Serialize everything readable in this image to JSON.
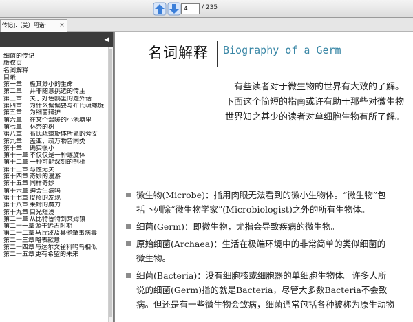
{
  "toolbar": {
    "prev_icon": "arrow-up-icon",
    "next_icon": "arrow-down-icon",
    "current_page": "4",
    "total_pages": "/ 235",
    "accent": "#3b7fd9"
  },
  "tab": {
    "title": "传记].（美）阿诺·",
    "close": "×"
  },
  "sidebar": {
    "collapse": "◀",
    "items": [
      {
        "ch": "",
        "label": "细菌的传记"
      },
      {
        "ch": "",
        "label": "版权页"
      },
      {
        "ch": "",
        "label": "名词解释"
      },
      {
        "ch": "",
        "label": "目录"
      },
      {
        "ch": "第一章",
        "label": "极其渺小的生命"
      },
      {
        "ch": "第二章",
        "label": "并非随意挑选的传主"
      },
      {
        "ch": "第三章",
        "label": "关于好色鸥鉴的题外话"
      },
      {
        "ch": "第四章",
        "label": "为什么偏偏要写布氏疏螺旋"
      },
      {
        "ch": "第五章",
        "label": "为细菌辩护"
      },
      {
        "ch": "第六章",
        "label": "在某个温暖的小池塘里"
      },
      {
        "ch": "第七章",
        "label": "林奈的树"
      },
      {
        "ch": "第八章",
        "label": "布氏疏螺旋体所处的旁支"
      },
      {
        "ch": "第九章",
        "label": "盖亚，疏万物皆同类"
      },
      {
        "ch": "第十章",
        "label": "确实很小"
      },
      {
        "ch": "第十一章",
        "label": "不仅仅是一种螺旋体"
      },
      {
        "ch": "第十二章",
        "label": "一种可能深刻的剖析"
      },
      {
        "ch": "第十三章",
        "label": "与性无关"
      },
      {
        "ch": "第十四章",
        "label": "奇妙的漫游"
      },
      {
        "ch": "第十五章",
        "label": "同样奇妙"
      },
      {
        "ch": "第十六章",
        "label": "蜱会生病吗"
      },
      {
        "ch": "第十七章",
        "label": "皮疹的发现"
      },
      {
        "ch": "第十八章",
        "label": "莱姆的魔力"
      },
      {
        "ch": "第十九章",
        "label": "目光短浅"
      },
      {
        "ch": "第二十章",
        "label": "从比特鲁特到莱姆镇"
      },
      {
        "ch": "第二十一章",
        "label": "源于远古时期"
      },
      {
        "ch": "第二十二章",
        "label": "马丘波及其他肇事病毒"
      },
      {
        "ch": "第二十三章",
        "label": "略表歉意"
      },
      {
        "ch": "第二十四章",
        "label": "与达尔文雀科鸣鸟相似"
      },
      {
        "ch": "第二十五章",
        "label": "更有希望的未来"
      }
    ]
  },
  "document": {
    "title_zh": "名词解释",
    "title_en": "Biography of a  Germ",
    "title_en_color": "#3a87a6",
    "intro_lines": [
      "有些读者对于微生物的世界有大致的了解。",
      "下面这个简短的指南或许有助于那些对微生物",
      "世界知之甚少的读者对单细胞生物有所了解。"
    ],
    "definitions": [
      {
        "lines": [
          "微生物(Microbe)：指用肉眼无法看到的微小生物体。“微生物”包",
          "括下列除“微生物学家”(Microbiologist)之外的所有生物体。"
        ]
      },
      {
        "lines": [
          "细菌(Germ)：即微生物，尤指会导致疾病的微生物。"
        ]
      },
      {
        "lines": [
          "原始细菌(Archaea)：生活在极端环境中的非常简单的类似细菌的",
          "微生物。"
        ]
      },
      {
        "lines": [
          "细菌(Bacteria)：没有细胞核或细胞器的单细胞生物体。许多人所",
          "说的细菌(Germ)指的就是Bacteria，尽管大多数Bacteria不会致",
          "病。但还是有一些微生物会致病，细菌通常包括各种被称为原生动物"
        ]
      }
    ]
  }
}
